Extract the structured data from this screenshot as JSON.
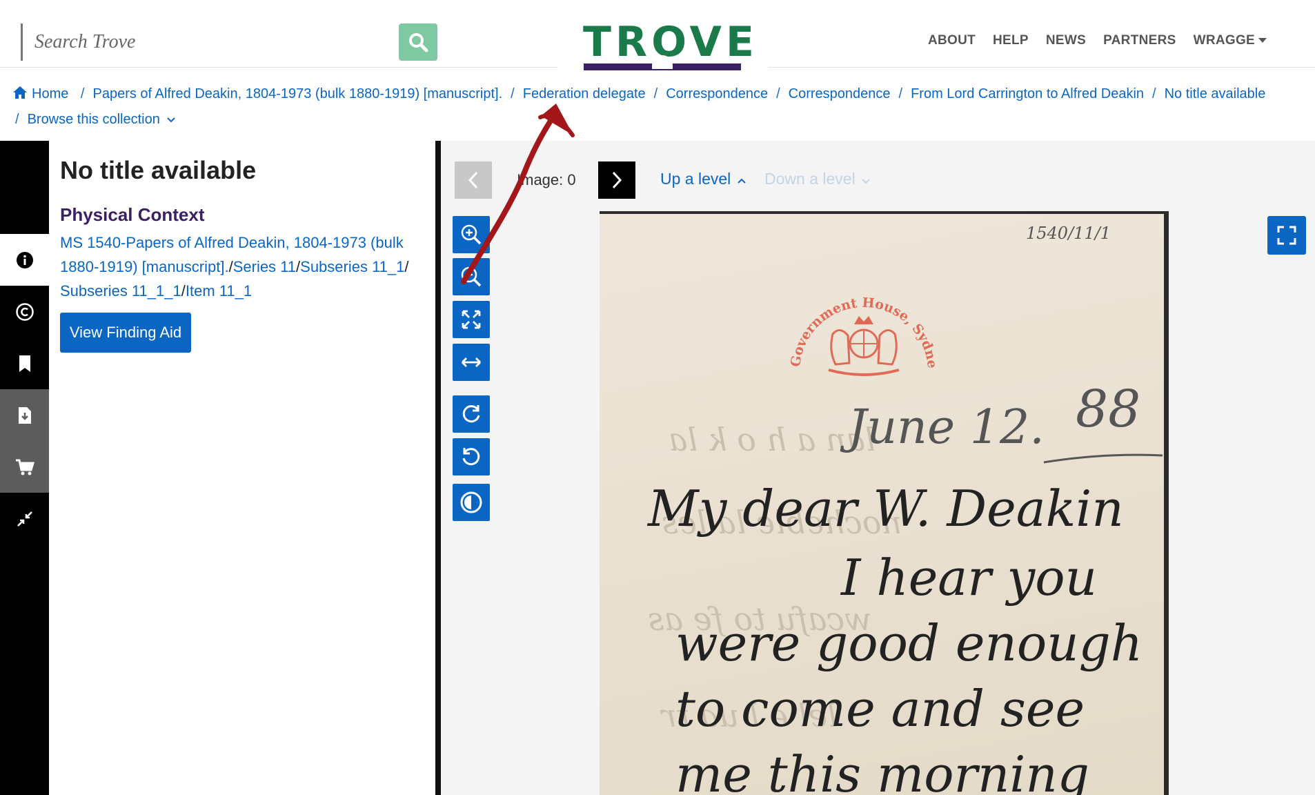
{
  "header": {
    "search_placeholder": "Search Trove",
    "logo_text": "TROVE",
    "nav": [
      "ABOUT",
      "HELP",
      "NEWS",
      "PARTNERS",
      "WRAGGE"
    ]
  },
  "breadcrumb": {
    "items": [
      "Home",
      "Papers of Alfred Deakin, 1804-1973 (bulk 1880-1919) [manuscript].",
      "Federation delegate",
      "Correspondence",
      "Correspondence",
      "From Lord Carrington to Alfred Deakin",
      "No title available"
    ],
    "browse": "Browse this collection"
  },
  "info": {
    "title": "No title available",
    "section": "Physical Context",
    "context_links": [
      "MS 1540-Papers of Alfred Deakin, 1804-1973 (bulk 1880-1919) [manuscript].",
      "Series 11",
      "Subseries 11_1",
      "Subseries 11_1_1",
      "Item 11_1"
    ],
    "finding_aid_button": "View Finding Aid"
  },
  "viewer": {
    "image_label": "Image: 0",
    "up_level": "Up a level",
    "down_level": "Down a level"
  },
  "document": {
    "ref": "1540/11/1",
    "crest": "Government House, Sydney",
    "date": "June 12.",
    "year": "88",
    "lines": [
      "My dear W. Deakin",
      "I hear you",
      "were good enough",
      "to come and see",
      "me this morning"
    ]
  },
  "colors": {
    "link": "#0a66c2",
    "accent_green": "#1a7a4a",
    "accent_purple": "#3b1f63",
    "annotation": "#a3171b"
  }
}
